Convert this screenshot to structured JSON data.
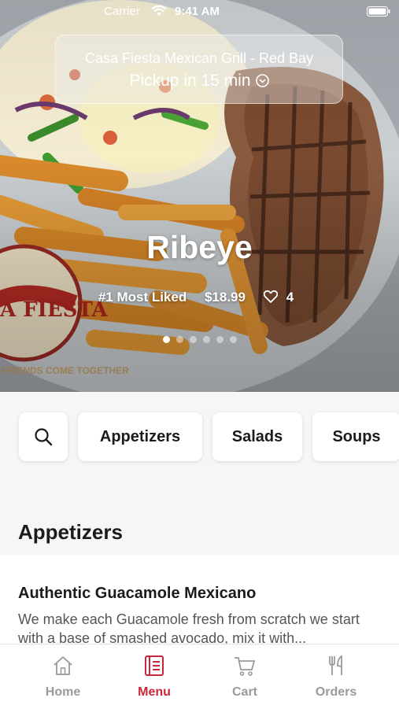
{
  "status_bar": {
    "carrier": "Carrier",
    "time": "9:41 AM"
  },
  "location": {
    "restaurant": "Casa Fiesta Mexican Grill - Red Bay",
    "pickup": "Pickup in 15 min"
  },
  "featured": {
    "title": "Ribeye",
    "badge": "#1 Most Liked",
    "price": "$18.99",
    "likes": "4",
    "slide_count": 6,
    "active_slide": 0
  },
  "categories": [
    "Appetizers",
    "Salads",
    "Soups"
  ],
  "section": {
    "title": "Appetizers",
    "items": [
      {
        "name": "Authentic Guacamole Mexicano",
        "description": "We make each Guacamole fresh from scratch we start with a base of smashed avocado, mix it with..."
      }
    ]
  },
  "tabs": [
    {
      "label": "Home",
      "icon": "home-icon"
    },
    {
      "label": "Menu",
      "icon": "menu-icon",
      "active": true
    },
    {
      "label": "Cart",
      "icon": "cart-icon"
    },
    {
      "label": "Orders",
      "icon": "orders-icon"
    }
  ],
  "colors": {
    "accent": "#c8263a",
    "inactive": "#9a9a9a"
  }
}
